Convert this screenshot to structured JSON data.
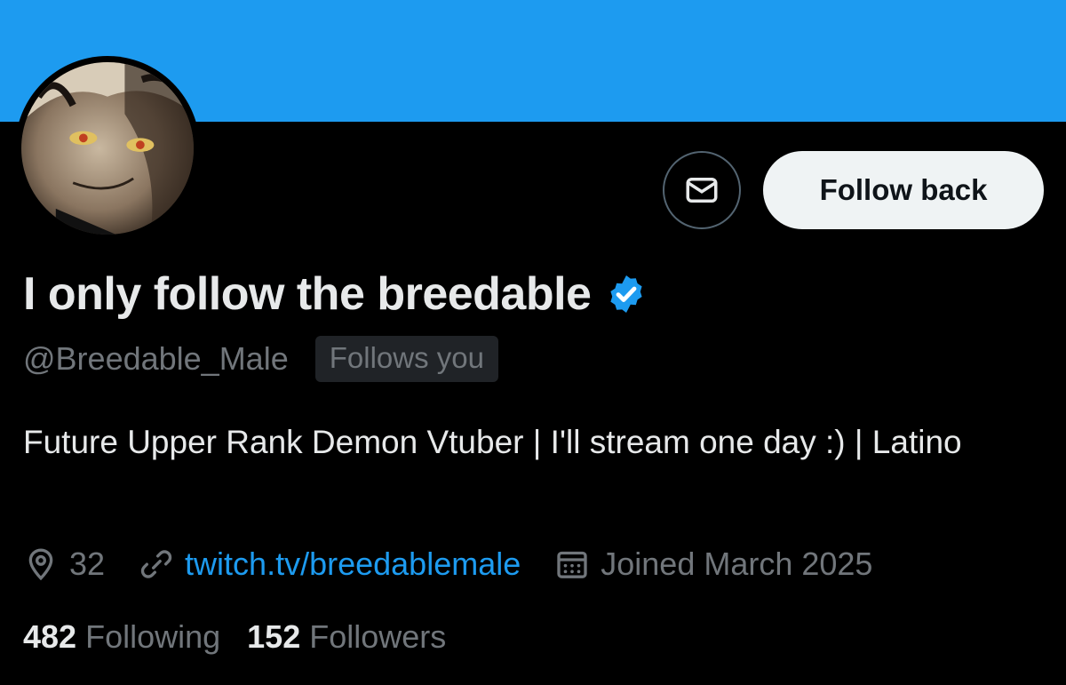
{
  "profile": {
    "display_name": "I only follow the breedable",
    "handle": "@Breedable_Male",
    "follows_you_badge": "Follows you",
    "bio": "Future Upper Rank Demon Vtuber | I'll stream one day :) | Latino",
    "verified": true
  },
  "actions": {
    "follow_back_label": "Follow back",
    "message_icon": "envelope-icon"
  },
  "meta": {
    "location": "32",
    "website": "twitch.tv/breedablemale",
    "joined": "Joined March 2025"
  },
  "stats": {
    "following_count": "482",
    "following_label": "Following",
    "followers_count": "152",
    "followers_label": "Followers"
  },
  "colors": {
    "banner": "#1d9bf0",
    "accent": "#1d9bf0",
    "secondary_text": "#71767b",
    "background": "#000000"
  }
}
